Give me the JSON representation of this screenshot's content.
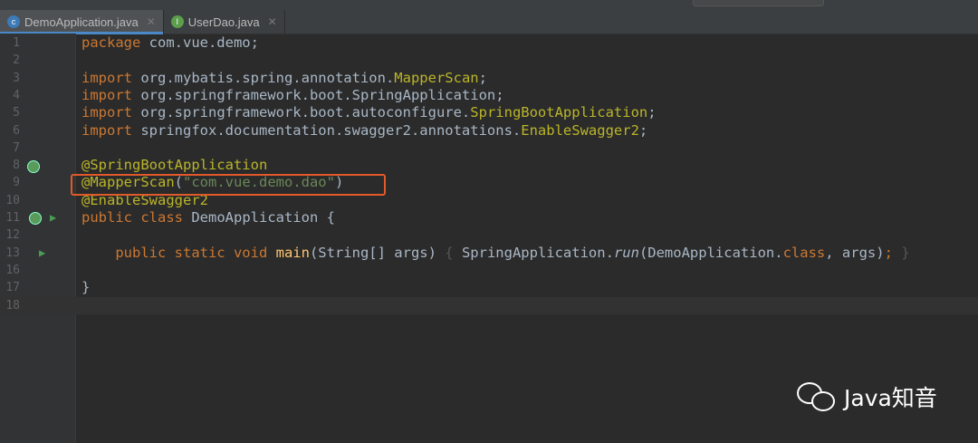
{
  "tabs": [
    {
      "label": "DemoApplication.java",
      "active": true,
      "icon": "spring-class-icon"
    },
    {
      "label": "UserDao.java",
      "active": false,
      "icon": "interface-icon"
    }
  ],
  "lines": [
    {
      "n": "1",
      "tokens": [
        [
          "kw",
          "package "
        ],
        [
          "",
          "com.vue.demo;"
        ]
      ]
    },
    {
      "n": "2",
      "tokens": []
    },
    {
      "n": "3",
      "tokens": [
        [
          "kw",
          "import "
        ],
        [
          "",
          "org.mybatis.spring.annotation."
        ],
        [
          "an",
          "MapperScan"
        ],
        [
          "",
          "; "
        ]
      ]
    },
    {
      "n": "4",
      "tokens": [
        [
          "kw",
          "import "
        ],
        [
          "",
          "org.springframework.boot.SpringApplication;"
        ]
      ]
    },
    {
      "n": "5",
      "tokens": [
        [
          "kw",
          "import "
        ],
        [
          "",
          "org.springframework.boot.autoconfigure."
        ],
        [
          "an",
          "SpringBootApplication"
        ],
        [
          "",
          ";"
        ]
      ]
    },
    {
      "n": "6",
      "tokens": [
        [
          "kw",
          "import "
        ],
        [
          "",
          "springfox.documentation.swagger2.annotations."
        ],
        [
          "an",
          "EnableSwagger2"
        ],
        [
          "",
          ";"
        ]
      ]
    },
    {
      "n": "7",
      "tokens": []
    },
    {
      "n": "8",
      "tokens": [
        [
          "an",
          "@SpringBootApplication"
        ]
      ]
    },
    {
      "n": "9",
      "tokens": [
        [
          "an",
          "@MapperScan"
        ],
        [
          "",
          "("
        ],
        [
          "st",
          "\"com.vue.demo.dao\""
        ],
        [
          "",
          ")"
        ]
      ]
    },
    {
      "n": "10",
      "tokens": [
        [
          "an",
          "@EnableSwagger2"
        ]
      ]
    },
    {
      "n": "11",
      "tokens": [
        [
          "kw",
          "public class "
        ],
        [
          "",
          "DemoApplication {"
        ]
      ]
    },
    {
      "n": "12",
      "tokens": []
    },
    {
      "n": "13",
      "tokens": [
        [
          "kw",
          "    public static void "
        ],
        [
          "fn",
          "main"
        ],
        [
          "",
          "(String[] args) "
        ],
        [
          "fold",
          "{ "
        ],
        [
          "",
          "SpringApplication."
        ],
        [
          "it",
          "run"
        ],
        [
          "",
          "(DemoApplication."
        ],
        [
          "kw",
          "class"
        ],
        [
          "",
          ", args)"
        ],
        [
          "kw",
          "; "
        ],
        [
          "fold",
          "}"
        ]
      ]
    },
    {
      "n": "16",
      "tokens": []
    },
    {
      "n": "17",
      "tokens": [
        [
          "",
          "}"
        ]
      ]
    },
    {
      "n": "18",
      "tokens": []
    }
  ],
  "watermark": {
    "text": "Java知音"
  },
  "colors": {
    "keyword": "#cc7832",
    "annotation": "#bbb529",
    "string": "#6a8759",
    "highlight_box": "#e05a2a"
  }
}
